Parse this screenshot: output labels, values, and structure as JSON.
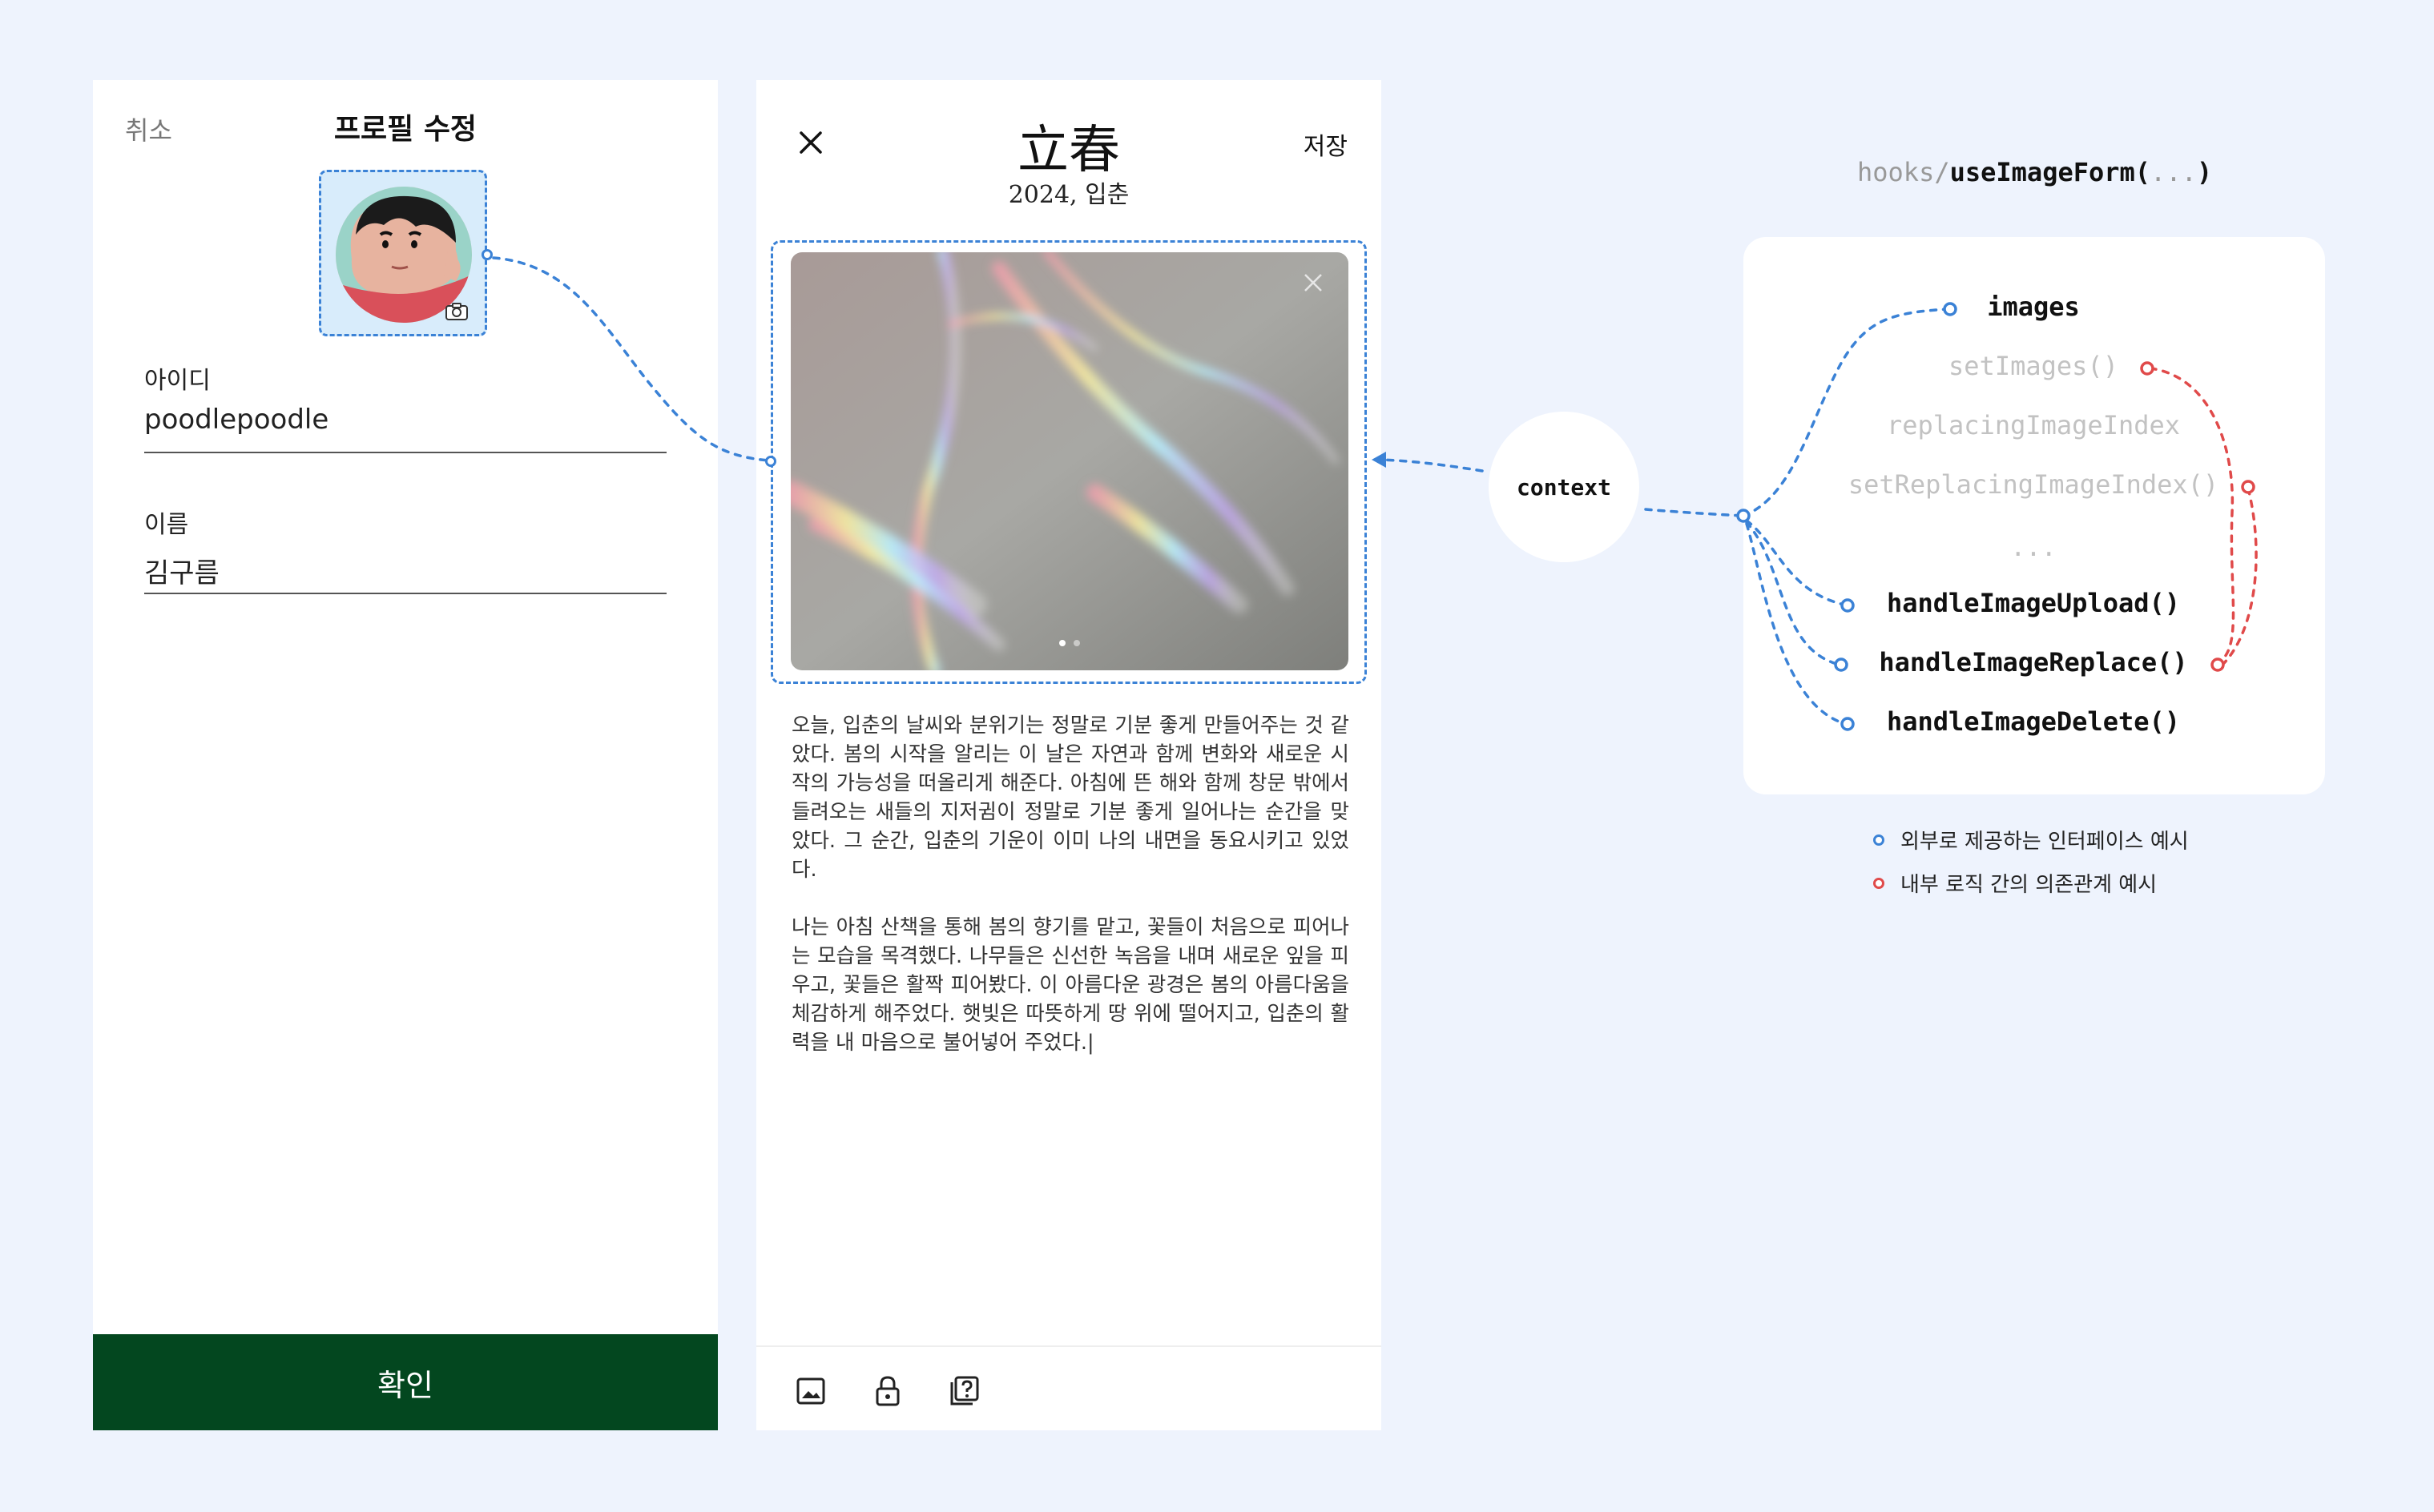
{
  "profile_edit": {
    "cancel_label": "취소",
    "title": "프로필 수정",
    "fields": [
      {
        "label": "아이디",
        "value": "poodlepoodle"
      },
      {
        "label": "이름",
        "value": "김구름"
      }
    ],
    "confirm_label": "확인"
  },
  "diary_editor": {
    "title": "立春",
    "subtitle": "2024, 입춘",
    "save_label": "저장",
    "image_pages": {
      "total": 2,
      "current": 1
    },
    "paragraph_1": "오늘, 입춘의 날씨와 분위기는 정말로 기분 좋게 만들어주는 것 같았다. 봄의 시작을 알리는 이 날은 자연과 함께 변화와 새로운 시작의 가능성을 떠올리게 해준다. 아침에 뜬 해와 함께 창문 밖에서 들려오는 새들의 지저귐이 정말로 기분 좋게 일어나는 순간을 맞았다. 그 순간, 입춘의 기운이 이미 나의 내면을 동요시키고 있었다.",
    "paragraph_2": "나는 아침 산책을 통해 봄의 향기를 맡고, 꽃들이 처음으로 피어나는 모습을 목격했다. 나무들은 신선한 녹음을 내며 새로운 잎을 피우고, 꽃들은 활짝 피어봤다. 이 아름다운 광경은 봄의 아름다움을 체감하게 해주었다. 햇빛은 따뜻하게 땅 위에 떨어지고, 입춘의 활력을 내 마음으로 불어넣어 주었다.|",
    "toolbar_icons": [
      "image-icon",
      "lock-icon",
      "question-icon"
    ]
  },
  "diagram": {
    "hook_prefix": "hooks/",
    "hook_name": "useImageForm(",
    "hook_args": "...",
    "hook_close": ")",
    "context_label": "context",
    "items": [
      {
        "label": "images",
        "style": "strong"
      },
      {
        "label": "setImages()",
        "style": "faint"
      },
      {
        "label": "replacingImageIndex",
        "style": "faint"
      },
      {
        "label": "setReplacingImageIndex()",
        "style": "faint"
      },
      {
        "label": "...",
        "style": "faint"
      },
      {
        "label": "handleImageUpload()",
        "style": "strong"
      },
      {
        "label": "handleImageReplace()",
        "style": "strong"
      },
      {
        "label": "handleImageDelete()",
        "style": "strong"
      }
    ],
    "legend": [
      {
        "label": "외부로 제공하는 인터페이스 예시",
        "color": "#3b82d6"
      },
      {
        "label": "내부 로직 간의 의존관계 예시",
        "color": "#e04a4a"
      }
    ]
  },
  "colors": {
    "background": "#eef3fd",
    "accent_blue": "#3b82d6",
    "accent_red": "#e04a4a",
    "confirm_green": "#03471f"
  }
}
